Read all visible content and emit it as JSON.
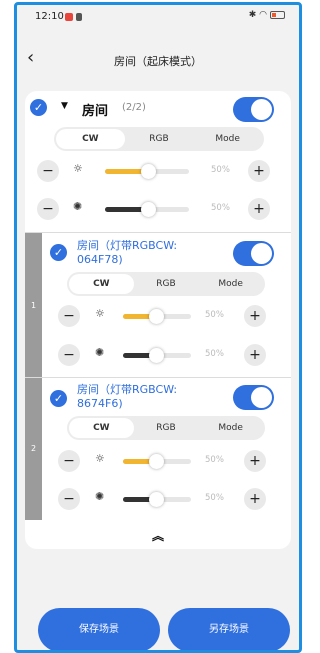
{
  "status": {
    "time": "12:10",
    "right_icons": "✱ ◠",
    "battery_fill": 0.25
  },
  "title": "房间（起床模式）",
  "room": {
    "name": "房间",
    "count": "(2/2)",
    "on": true
  },
  "tabs": [
    "CW",
    "RGB",
    "Mode"
  ],
  "brightness_pct": "50%",
  "warmth_pct": "50%",
  "devices": [
    {
      "index": "1",
      "name_line1": "房间（灯带RGBCW:",
      "name_line2": "064F78)",
      "on": true,
      "brightness_pct": "50%",
      "warmth_pct": "50%"
    },
    {
      "index": "2",
      "name_line1": "房间（灯带RGBCW:",
      "name_line2": "8674F6)",
      "on": true,
      "brightness_pct": "50%",
      "warmth_pct": "50%"
    }
  ],
  "buttons": {
    "save": "保存场景",
    "save_as": "另存场景"
  },
  "colors": {
    "accent": "#2f6fde",
    "warm_slider": "#f2b530",
    "dark_slider": "#333333",
    "frame": "#1e8fe0"
  }
}
